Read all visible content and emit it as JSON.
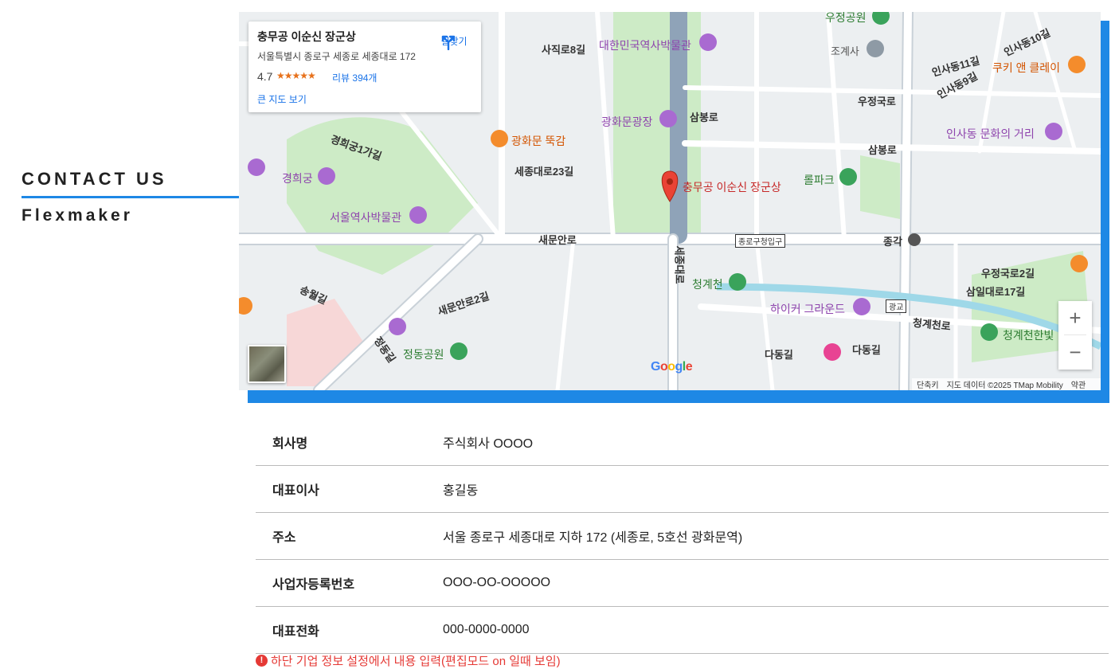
{
  "header": {
    "title": "CONTACT US",
    "brand": "Flexmaker"
  },
  "map": {
    "card": {
      "title": "충무공 이순신 장군상",
      "address": "서울특별시 종로구 세종로 세종대로 172",
      "rating": "4.7",
      "stars": "★★★★★",
      "reviews": "리뷰 394개",
      "large_map": "큰 지도 보기",
      "directions": "길찾기"
    },
    "labels": {
      "marker": "충무공 이순신 장군상",
      "museum_korea": "대한민국역사박물관",
      "gwanghwamun_square": "광화문광장",
      "gwanghwamun_ttukgam": "광화문 뚝감",
      "gyeonghuigung": "경희궁",
      "seoul_museum": "서울역사박물관",
      "cheonggyecheon": "청계천",
      "hiker_ground": "하이커 그라운드",
      "insadong": "인사동 문화의 거리",
      "woojeong_park": "우정공원",
      "jogyesa": "조계사",
      "cookie": "쿠키 앤 클레이",
      "lolpark": "롤파크",
      "jeongdong_park": "정동공원",
      "cheonggye_hanbit": "청계천한빛",
      "samilro": "삼일대로17길",
      "sejongdaero23": "세종대로23길",
      "saemunanro": "새문안로",
      "jonggak": "종각",
      "samborno": "삼봉로",
      "samborno2": "삼봉로",
      "sajikro": "사직로8길",
      "gyeonghuigung1": "경희궁1가길",
      "dadong": "다동길",
      "dadong2": "다동길",
      "cheonggyecheonro": "청계천로",
      "woojeongro": "우정국로",
      "woojeongro2": "우정국로2길",
      "insadong11": "인사동11길",
      "insadong9": "인사동9길",
      "insadong10": "인사동10길",
      "songwol": "송월길",
      "jongro_gu_office": "종로구청입구",
      "gwanggyo": "광교",
      "sejongdaero_v": "세종대로",
      "saemunan2": "새문안로2길",
      "jeongdong": "정동길"
    },
    "zoom_in": "+",
    "zoom_out": "−",
    "google": "Google",
    "footer": {
      "shortcuts": "단축키",
      "data": "지도 데이터 ©2025 TMap Mobility",
      "terms": "약관"
    }
  },
  "company": {
    "rows": [
      {
        "label": "회사명",
        "value": "주식회사 OOOO"
      },
      {
        "label": "대표이사",
        "value": "홍길동"
      },
      {
        "label": "주소",
        "value": "서울 종로구 세종대로 지하 172 (세종로, 5호선 광화문역)"
      },
      {
        "label": "사업자등록번호",
        "value": "OOO-OO-OOOOO"
      },
      {
        "label": "대표전화",
        "value": "000-0000-0000"
      }
    ],
    "warning": "하단 기업 정보 설정에서 내용 입력(편집모드 on 일때 보임)"
  }
}
